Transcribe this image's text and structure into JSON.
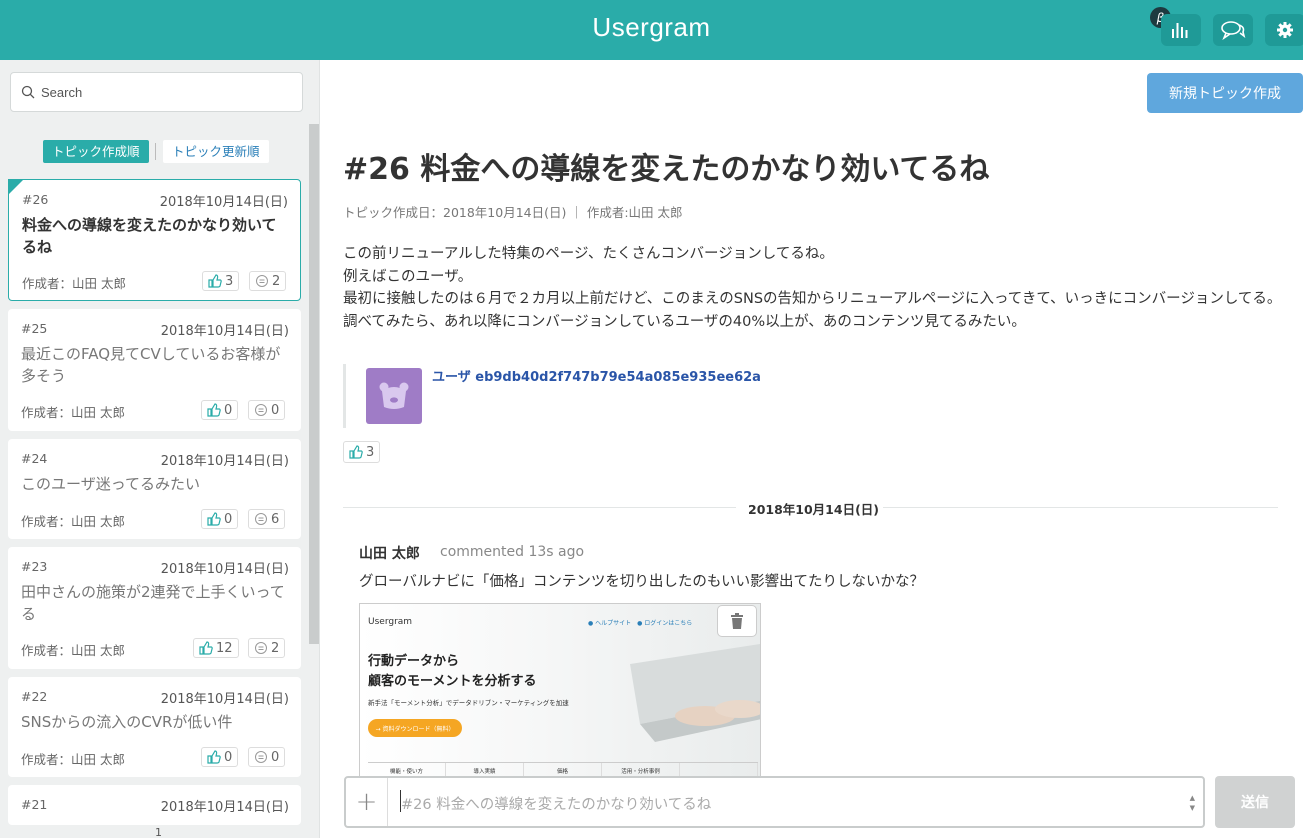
{
  "app": {
    "title": "Usergram",
    "beta_badge": "β"
  },
  "header_buttons": [
    {
      "icon": "bar-chart-icon"
    },
    {
      "icon": "chat-bubbles-icon"
    },
    {
      "icon": "gear-icon"
    }
  ],
  "sidebar": {
    "search_placeholder": "Search",
    "sort_created": "トピック作成順",
    "sort_updated": "トピック更新順",
    "page_indicator": "1",
    "topics": [
      {
        "number": "#26",
        "date": "2018年10月14日(日)",
        "title": "料金への導線を変えたのかなり効いてるね",
        "author": "作成者：山田 太郎",
        "likes": "3",
        "comments": "2",
        "active": true
      },
      {
        "number": "#25",
        "date": "2018年10月14日(日)",
        "title": "最近このFAQ見てCVしているお客様が多そう",
        "author": "作成者：山田 太郎",
        "likes": "0",
        "comments": "0"
      },
      {
        "number": "#24",
        "date": "2018年10月14日(日)",
        "title": "このユーザ迷ってるみたい",
        "author": "作成者：山田 太郎",
        "likes": "0",
        "comments": "6"
      },
      {
        "number": "#23",
        "date": "2018年10月14日(日)",
        "title": "田中さんの施策が2連発で上手くいってる",
        "author": "作成者：山田 太郎",
        "likes": "12",
        "comments": "2"
      },
      {
        "number": "#22",
        "date": "2018年10月14日(日)",
        "title": "SNSからの流入のCVRが低い件",
        "author": "作成者：山田 太郎",
        "likes": "0",
        "comments": "0"
      },
      {
        "number": "#21",
        "date": "2018年10月14日(日)",
        "title": "",
        "author": "",
        "likes": "",
        "comments": ""
      }
    ]
  },
  "main": {
    "new_topic_button": "新規トピック作成",
    "topic_title": "#26 料金への導線を変えたのかなり効いてるね",
    "meta": "トピック作成日：2018年10月14日(日) ｜ 作成者:山田 太郎",
    "body_lines": [
      "この前リニューアルした特集のページ、たくさんコンバージョンしてるね。",
      "例えばこのユーザ。",
      "最初に接触したのは６月で２カ月以上前だけど、このまえのSNSの告知からリニューアルページに入ってきて、いっきにコンバージョンしてる。",
      "調べてみたら、あれ以降にコンバージョンしているユーザの40%以上が、あのコンテンツ見てるみたい。"
    ],
    "user_link": "ユーザ eb9db40d2f747b79e54a085e935ee62a",
    "topic_likes": "3",
    "date_divider": "2018年10月14日(日)",
    "comment": {
      "author": "山田 太郎",
      "ago": "commented 13s ago",
      "text": "グローバルナビに「価格」コンテンツを切り出したのもいい影響出てたりしないかな？"
    },
    "attachment": {
      "logo": "Usergram",
      "links": "● ヘルプサイト　● ログインはこちら",
      "headline_1": "行動データから",
      "headline_2": "顧客のモーメントを分析する",
      "sub": "新手法「モーメント分析」でデータドリブン・マーケティングを加速",
      "button": "→ 資料ダウンロード（無料）",
      "tabs": [
        "機能・使い方",
        "導入実績",
        "価格",
        "活用・分析事例",
        ""
      ]
    },
    "composer_placeholder": "#26 料金への導線を変えたのかなり効いてるね",
    "send_button": "送信"
  }
}
